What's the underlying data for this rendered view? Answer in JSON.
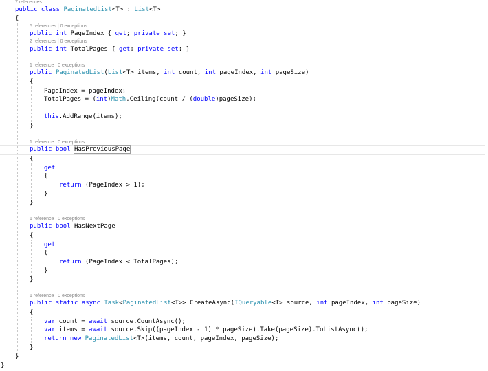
{
  "lens": {
    "class_refs": "7 references",
    "pageindex_refs": "5 references | 0 exceptions",
    "totalpages_refs": "2 references | 0 exceptions",
    "ctor_refs": "1 reference | 0 exceptions",
    "hasprev_refs": "1 reference | 0 exceptions",
    "hasnext_refs": "1 reference | 0 exceptions",
    "create_refs": "1 reference | 0 exceptions"
  },
  "code": {
    "l1": {
      "a": "public class",
      "b": "PaginatedList",
      "c": "<T> : ",
      "d": "List",
      "e": "<T>"
    },
    "brace_open": "{",
    "brace_close": "}",
    "pageindex": {
      "a": "public int",
      "b": " PageIndex { ",
      "c": "get",
      "d": "; ",
      "e": "private set",
      "f": "; }"
    },
    "totalpages": {
      "a": "public int",
      "b": " TotalPages { ",
      "c": "get",
      "d": "; ",
      "e": "private set",
      "f": "; }"
    },
    "ctor": {
      "a": "public",
      "b": "PaginatedList",
      "c": "(",
      "d": "List",
      "e": "<T> items, ",
      "f": "int",
      "g": " count, ",
      "h": "int",
      "i": " pageIndex, ",
      "j": "int",
      "k": " pageSize)"
    },
    "ctor_body1": "PageIndex = pageIndex;",
    "ctor_body2": {
      "a": "TotalPages = (",
      "b": "int",
      "c": ")",
      "d": "Math",
      "e": ".Ceiling(count / (",
      "f": "double",
      "g": ")pageSize);"
    },
    "ctor_body3": {
      "a": "this",
      "b": ".AddRange(items);"
    },
    "hasprev": {
      "a": "public bool",
      "b": "HasPreviousPage"
    },
    "get": "get",
    "return_prev": {
      "a": "return",
      "b": " (PageIndex > 1);"
    },
    "hasnext": {
      "a": "public bool",
      "b": " HasNextPage"
    },
    "return_next": {
      "a": "return",
      "b": " (PageIndex < TotalPages);"
    },
    "create": {
      "a": "public static async",
      "b": "Task",
      "c": "<",
      "d": "PaginatedList",
      "e": "<T>> CreateAsync(",
      "f": "IQueryable",
      "g": "<T> source, ",
      "h": "int",
      "i": " pageIndex, ",
      "j": "int",
      "k": " pageSize)"
    },
    "count_line": {
      "a": "var",
      "b": " count = ",
      "c": "await",
      "d": " source.CountAsync();"
    },
    "items_line": {
      "a": "var",
      "b": " items = ",
      "c": "await",
      "d": " source.Skip((pageIndex - 1) * pageSize).Take(pageSize).ToListAsync();"
    },
    "return_new": {
      "a": "return new",
      "b": "PaginatedList",
      "c": "<T>(items, count, pageIndex, pageSize);"
    }
  },
  "colors": {
    "keyword": "#0000ff",
    "type": "#2b91af",
    "lens": "#8a8a8a"
  }
}
